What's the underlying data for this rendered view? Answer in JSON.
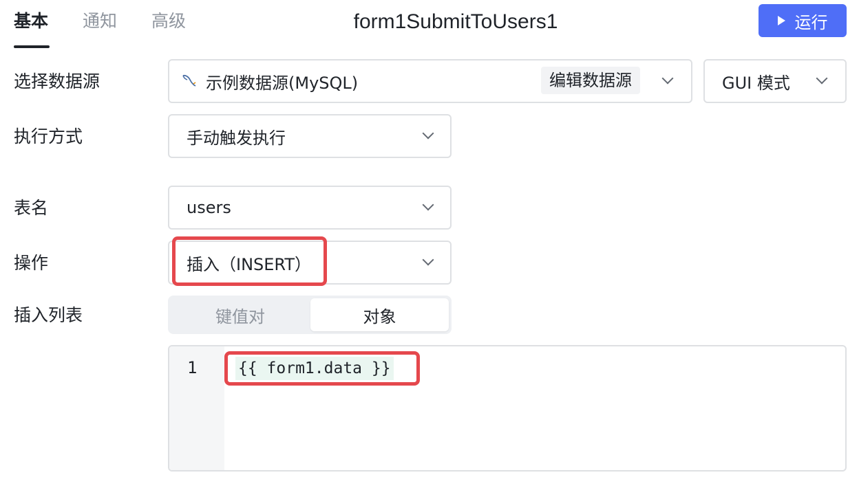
{
  "tabs": [
    {
      "label": "基本",
      "active": true
    },
    {
      "label": "通知",
      "active": false
    },
    {
      "label": "高级",
      "active": false
    }
  ],
  "query_name": "form1SubmitToUsers1",
  "run_button": {
    "label": "运行"
  },
  "form": {
    "datasource": {
      "label": "选择数据源",
      "value": "示例数据源(MySQL)",
      "icon": "mysql-dolphin-icon",
      "edit_label": "编辑数据源",
      "mode_value": "GUI 模式"
    },
    "exec_mode": {
      "label": "执行方式",
      "value": "手动触发执行"
    },
    "table": {
      "label": "表名",
      "value": "users"
    },
    "operation": {
      "label": "操作",
      "value": "插入（INSERT）"
    },
    "insert_list": {
      "label": "插入列表",
      "options": [
        "键值对",
        "对象"
      ],
      "selected": "对象"
    }
  },
  "editor": {
    "line_numbers": [
      "1"
    ],
    "code": "{{ form1.data }}"
  },
  "colors": {
    "primary": "#4f6ef7",
    "highlight": "#e5484d",
    "border": "#dee0e3"
  }
}
